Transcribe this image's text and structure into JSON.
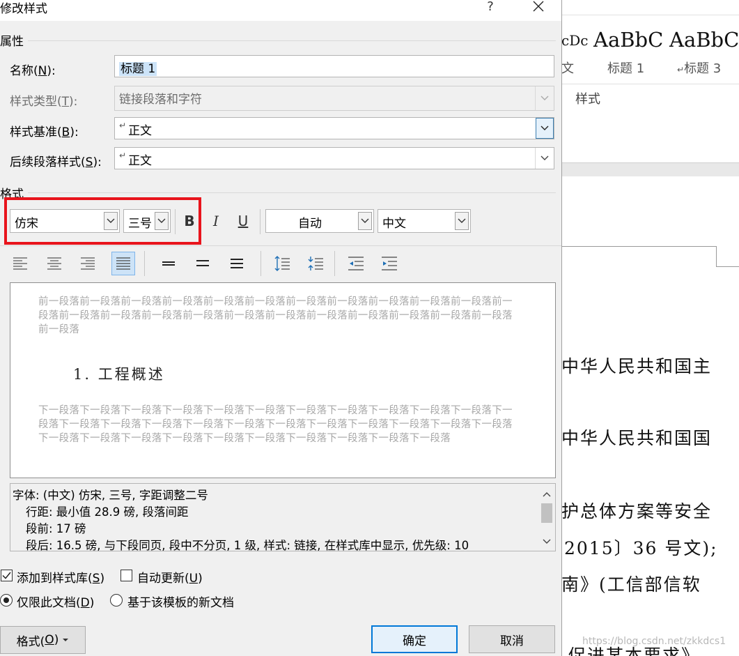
{
  "document": {
    "gallery": [
      {
        "sample": "cDc",
        "label": "文"
      },
      {
        "sample": "AaBbC",
        "label": "标题 1"
      },
      {
        "sample": "AaBbC",
        "label": "标题 3"
      }
    ],
    "styles_group": "样式",
    "lines": [
      "中华人民共和国主",
      "中华人民共和国国",
      "护总体方案等安全",
      "2015〕36 号文);",
      "南》(工信部信软",
      "促进某本要求》"
    ],
    "watermark": "https://blog.csdn.net/zkkdcs1"
  },
  "dialog": {
    "title": "修改样式",
    "help": "?",
    "properties": {
      "header": "属性",
      "name_label": "名称(",
      "name_key": "N",
      "name_suffix": "):",
      "name_value": "标题 1",
      "type_label": "样式类型(",
      "type_key": "T",
      "type_suffix": "):",
      "type_value": "链接段落和字符",
      "base_label": "样式基准(",
      "base_key": "B",
      "base_suffix": "):",
      "base_value": "正文",
      "next_label": "后续段落样式(",
      "next_key": "S",
      "next_suffix": "):",
      "next_value": "正文"
    },
    "format": {
      "header": "格式",
      "font": "仿宋",
      "size": "三号",
      "bold": "B",
      "italic": "I",
      "underline": "U",
      "color": "自动",
      "script": "中文"
    },
    "preview": {
      "before": "前一段落前一段落前一段落前一段落前一段落前一段落前一段落前一段落前一段落前一段落前一段落前一段落前一段落前一段落前一段落前一段落前一段落前一段落前一段落前一段落前一段落前一段落前一段落前一段落",
      "heading": "1. 工程概述",
      "after": "下一段落下一段落下一段落下一段落下一段落下一段落下一段落下一段落下一段落下一段落下一段落下一段落下一段落下一段落下一段落下一段落下一段落下一段落下一段落下一段落下一段落下一段落下一段落下一段落下一段落下一段落下一段落下一段落下一段落下一段落下一段落下一段落下一段落"
    },
    "description": [
      "字体: (中文) 仿宋, 三号, 字距调整二号",
      "行距: 最小值 28.9 磅, 段落间距",
      "段前: 17 磅",
      "段后: 16.5 磅, 与下段同页, 段中不分页, 1 级, 样式: 链接, 在样式库中显示, 优先级: 10"
    ],
    "options": {
      "add_to_gallery": "添加到样式库(",
      "add_key": "S",
      "add_suffix": ")",
      "auto_update": "自动更新(",
      "auto_key": "U",
      "auto_suffix": ")",
      "this_doc": "仅限此文档(",
      "this_key": "D",
      "this_suffix": ")",
      "new_docs": "基于该模板的新文档"
    },
    "buttons": {
      "format": "格式(",
      "format_key": "O",
      "format_suffix": ")",
      "ok": "确定",
      "cancel": "取消"
    }
  }
}
